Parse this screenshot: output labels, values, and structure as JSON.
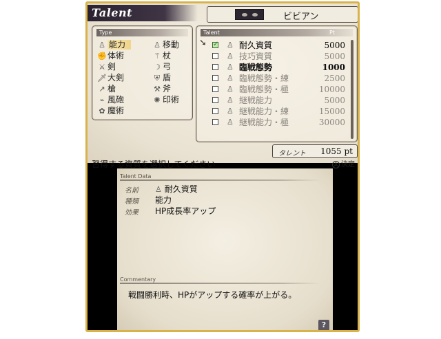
{
  "header": {
    "title": "Talent",
    "character_name": "ビビアン"
  },
  "type_panel": {
    "head": "Type",
    "items_left": [
      {
        "label": "能力",
        "icon": "person-icon",
        "selected": true
      },
      {
        "label": "体術",
        "icon": "fist-icon"
      },
      {
        "label": "剣",
        "icon": "sword-icon"
      },
      {
        "label": "大剣",
        "icon": "greatsword-icon"
      },
      {
        "label": "槍",
        "icon": "spear-icon"
      },
      {
        "label": "風砲",
        "icon": "cannon-icon"
      },
      {
        "label": "魔術",
        "icon": "magic-icon"
      }
    ],
    "items_right": [
      {
        "label": "移動",
        "icon": "person-move-icon"
      },
      {
        "label": "杖",
        "icon": "staff-icon"
      },
      {
        "label": "弓",
        "icon": "bow-icon"
      },
      {
        "label": "盾",
        "icon": "shield-icon"
      },
      {
        "label": "斧",
        "icon": "axe-icon"
      },
      {
        "label": "印術",
        "icon": "seal-icon"
      }
    ]
  },
  "talent_panel": {
    "head": "Talent",
    "pt_head": "Pt",
    "rows": [
      {
        "name": "耐久資質",
        "pt": "5000",
        "checked": true,
        "state": "selected"
      },
      {
        "name": "技巧資質",
        "pt": "5000",
        "checked": false,
        "state": "dim"
      },
      {
        "name": "臨戦態勢",
        "pt": "1000",
        "checked": false,
        "state": "strong"
      },
      {
        "name": "臨戦態勢・練",
        "pt": "2500",
        "checked": false,
        "state": "dim"
      },
      {
        "name": "臨戦態勢・極",
        "pt": "10000",
        "checked": false,
        "state": "dim"
      },
      {
        "name": "継戦能力",
        "pt": "5000",
        "checked": false,
        "state": "dim"
      },
      {
        "name": "継戦能力・練",
        "pt": "15000",
        "checked": false,
        "state": "dim"
      },
      {
        "name": "継戦能力・極",
        "pt": "30000",
        "checked": false,
        "state": "dim"
      }
    ]
  },
  "talent_points": {
    "label": "タレント",
    "value": "1055 pt"
  },
  "instruction": "習得する資質を選択してください",
  "decide": {
    "key": "Ⓐ",
    "label": "決定"
  },
  "detail": {
    "section_title": "Talent Data",
    "name_key": "名前",
    "name_value": "耐久資質",
    "type_key": "種類",
    "type_value": "能力",
    "effect_key": "効果",
    "effect_value": "HP成長率アップ",
    "commentary_title": "Commentary",
    "commentary_text": "戦闘勝利時、HPがアップする確率が上がる。",
    "help_label": "?"
  },
  "colors": {
    "frame": "#d9b24a",
    "selection": "#f0d58a",
    "header_bg": "#2b2230"
  }
}
